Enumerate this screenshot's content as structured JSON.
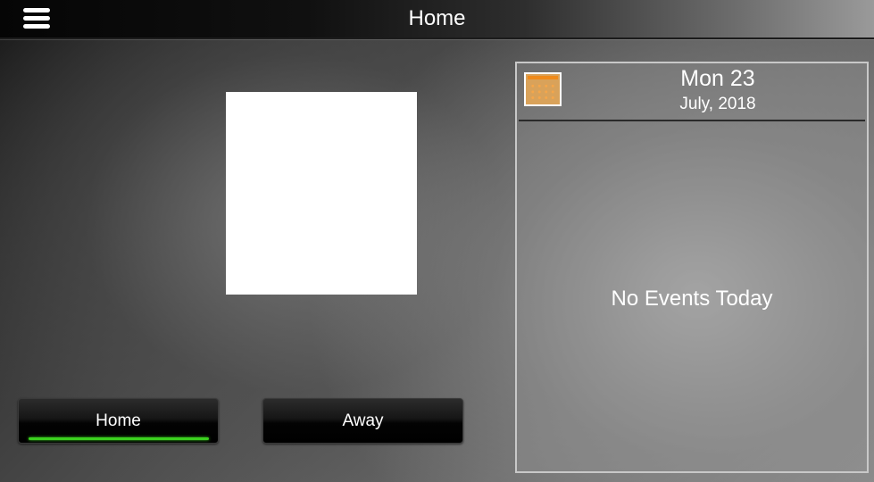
{
  "header": {
    "title": "Home",
    "menu_icon": "hamburger-menu-icon"
  },
  "modes": {
    "home_label": "Home",
    "away_label": "Away",
    "active": "Home",
    "active_indicator_color": "#3bd11f"
  },
  "calendar": {
    "icon": "calendar-icon",
    "icon_color": "#f08a1a",
    "day": "Mon 23",
    "month_year": "July, 2018",
    "empty_message": "No Events Today"
  }
}
